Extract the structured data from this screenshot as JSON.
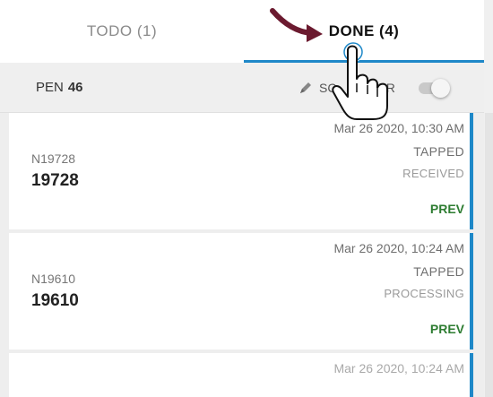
{
  "tabs": [
    {
      "label": "TODO (1)"
    },
    {
      "label": "DONE (4)"
    }
  ],
  "subbar": {
    "pen_label": "PEN",
    "pen_number": "46",
    "scanner_label": "SCANNER",
    "scanner_visible_start": "SC",
    "scanner_visible_end": "ER",
    "scanner_enabled": false
  },
  "items": [
    {
      "id_small": "N19728",
      "id_big": "19728",
      "date": "Mar 26 2020, 10:30 AM",
      "status": "TAPPED",
      "sub_status": "RECEIVED",
      "action": "PREV"
    },
    {
      "id_small": "N19610",
      "id_big": "19610",
      "date": "Mar 26 2020, 10:24 AM",
      "status": "TAPPED",
      "sub_status": "PROCESSING",
      "action": "PREV"
    },
    {
      "date": "Mar 26 2020, 10:24 AM"
    }
  ],
  "colors": {
    "accent": "#1e88c8",
    "prev": "#2e7d32",
    "annotation_arrow": "#6b1a2f"
  },
  "icons": {
    "scanner": "pen-icon",
    "pointer": "hand-pointer-icon",
    "arrow": "curved-arrow-icon"
  }
}
